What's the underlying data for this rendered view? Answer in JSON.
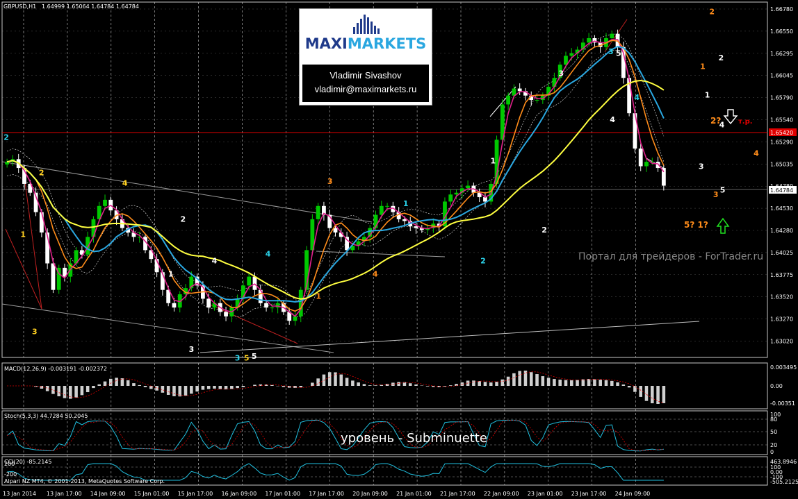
{
  "chart_header": {
    "symbol": "GBPUSD,H1",
    "ohlc": "1.64999 1.65064 1.64784 1.64784"
  },
  "logo": {
    "brand_part1": "MAXI",
    "brand_part2": "MARKETS",
    "name": "Vladimir Sivashov",
    "email": "vladimir@maximarkets.ru"
  },
  "watermark": "Портал для трейдеров - ForTrader.ru",
  "level_caption": "уровень - Subminuette",
  "copyright": "Alpari NZ MT4, © 2001-2013, MetaQuotes Software Corp.",
  "colors": {
    "background": "#000000",
    "grid": "#c8c8c8",
    "bull": "#00c800",
    "bear": "#ffffff",
    "ma_fast": "#e0208c",
    "ma_mid": "#ff8c1a",
    "ma_slow": "#2aa7e0",
    "ma_long": "#ffff40",
    "resistance_line": "#e00000"
  },
  "chart_data": [
    {
      "type": "candlestick",
      "title": "GBPUSD,H1",
      "y_ticks": [
        "1.66780",
        "1.66550",
        "1.66295",
        "1.66045",
        "1.65790",
        "1.65540",
        "1.65290",
        "1.65035",
        "1.64780",
        "1.64530",
        "1.64280",
        "1.64025",
        "1.63775",
        "1.63520",
        "1.63270",
        "1.63020"
      ],
      "ylim": [
        1.6298,
        1.6688
      ],
      "x_ticks": [
        "13 Jan 2014",
        "13 Jan 17:00",
        "14 Jan 09:00",
        "15 Jan 01:00",
        "15 Jan 17:00",
        "16 Jan 09:00",
        "17 Jan 01:00",
        "17 Jan 17:00",
        "20 Jan 09:00",
        "21 Jan 01:00",
        "21 Jan 17:00",
        "22 Jan 09:00",
        "23 Jan 01:00",
        "23 Jan 17:00",
        "24 Jan 09:00"
      ],
      "price_labels": {
        "red_line": "1.65420",
        "current": "1.64784"
      },
      "closes": [
        1.6505,
        1.6508,
        1.6498,
        1.648,
        1.647,
        1.6448,
        1.6425,
        1.639,
        1.636,
        1.6385,
        1.6375,
        1.639,
        1.6405,
        1.64,
        1.642,
        1.644,
        1.6455,
        1.6462,
        1.645,
        1.644,
        1.643,
        1.6425,
        1.642,
        1.642,
        1.6405,
        1.6395,
        1.638,
        1.636,
        1.6345,
        1.634,
        1.6355,
        1.6362,
        1.6375,
        1.6365,
        1.635,
        1.634,
        1.6345,
        1.6335,
        1.633,
        1.634,
        1.635,
        1.6365,
        1.6375,
        1.636,
        1.6345,
        1.634,
        1.634,
        1.6345,
        1.6335,
        1.6325,
        1.633,
        1.636,
        1.6405,
        1.644,
        1.6455,
        1.6445,
        1.643,
        1.6425,
        1.642,
        1.6405,
        1.641,
        1.6415,
        1.642,
        1.643,
        1.6445,
        1.6455,
        1.6455,
        1.6448,
        1.644,
        1.6438,
        1.6432,
        1.643,
        1.6428,
        1.643,
        1.6435,
        1.6432,
        1.646,
        1.6468,
        1.647,
        1.6475,
        1.6478,
        1.647,
        1.6465,
        1.646,
        1.648,
        1.653,
        1.657,
        1.658,
        1.6588,
        1.6585,
        1.658,
        1.6575,
        1.6575,
        1.658,
        1.659,
        1.66,
        1.6615,
        1.6625,
        1.6628,
        1.6632,
        1.664,
        1.6645,
        1.664,
        1.6635,
        1.6645,
        1.665,
        1.6635,
        1.66,
        1.656,
        1.652,
        1.65,
        1.6505,
        1.6505,
        1.6498,
        1.6478
      ],
      "series": [
        {
          "name": "",
          "color_key": "ma_fast"
        },
        {
          "name": "",
          "color_key": "ma_mid"
        },
        {
          "name": "",
          "color_key": "ma_slow"
        },
        {
          "name": "",
          "color_key": "ma_long"
        }
      ],
      "wave_labels": [
        {
          "text": "2",
          "color": "#2ad1e8",
          "t": 0.002,
          "p": 1.653
        },
        {
          "text": "2",
          "color": "#ffd020",
          "t": 0.048,
          "p": 1.649
        },
        {
          "text": "1",
          "color": "#ffd020",
          "t": 0.024,
          "p": 1.642
        },
        {
          "text": "3",
          "color": "#ffd020",
          "t": 0.039,
          "p": 1.631
        },
        {
          "text": "4",
          "color": "#ffd020",
          "t": 0.157,
          "p": 1.6478
        },
        {
          "text": "2",
          "color": "#ffffff",
          "t": 0.233,
          "p": 1.6437
        },
        {
          "text": "1",
          "color": "#ffffff",
          "t": 0.217,
          "p": 1.6375
        },
        {
          "text": "4",
          "color": "#ffffff",
          "t": 0.274,
          "p": 1.639
        },
        {
          "text": "3",
          "color": "#ffffff",
          "t": 0.244,
          "p": 1.629
        },
        {
          "text": "5",
          "color": "#ffffff",
          "t": 0.326,
          "p": 1.6282
        },
        {
          "text": "4",
          "color": "#2ad1e8",
          "t": 0.344,
          "p": 1.6398
        },
        {
          "text": "3",
          "color": "#2ad1e8",
          "t": 0.304,
          "p": 1.628
        },
        {
          "text": "5",
          "color": "#ffd020",
          "t": 0.316,
          "p": 1.628
        },
        {
          "text": "1",
          "color": "#ff8c1a",
          "t": 0.41,
          "p": 1.635
        },
        {
          "text": "3",
          "color": "#ff8c1a",
          "t": 0.425,
          "p": 1.648
        },
        {
          "text": "1",
          "color": "#2ad1e8",
          "t": 0.524,
          "p": 1.6455
        },
        {
          "text": "4",
          "color": "#ff8c1a",
          "t": 0.484,
          "p": 1.6375
        },
        {
          "text": "2",
          "color": "#2ad1e8",
          "t": 0.625,
          "p": 1.639
        },
        {
          "text": "1",
          "color": "#ffffff",
          "t": 0.638,
          "p": 1.6503
        },
        {
          "text": "2",
          "color": "#ffffff",
          "t": 0.705,
          "p": 1.6425
        },
        {
          "text": "3",
          "color": "#ffffff",
          "t": 0.727,
          "p": 1.6602
        },
        {
          "text": "3",
          "color": "#2ad1e8",
          "t": 0.792,
          "p": 1.6627
        },
        {
          "text": "5",
          "color": "#ffffff",
          "t": 0.802,
          "p": 1.6625
        },
        {
          "text": "4",
          "color": "#ffffff",
          "t": 0.794,
          "p": 1.655
        },
        {
          "text": "4",
          "color": "#2ad1e8",
          "t": 0.826,
          "p": 1.6575
        },
        {
          "text": "2",
          "color": "#ff8c1a",
          "t": 0.924,
          "p": 1.6672
        },
        {
          "text": "1",
          "color": "#ff8c1a",
          "t": 0.912,
          "p": 1.661
        },
        {
          "text": "2",
          "color": "#ffffff",
          "t": 0.936,
          "p": 1.662
        },
        {
          "text": "1",
          "color": "#ffffff",
          "t": 0.918,
          "p": 1.6578
        },
        {
          "text": "4",
          "color": "#ffffff",
          "t": 0.937,
          "p": 1.6544
        },
        {
          "text": "3",
          "color": "#ffffff",
          "t": 0.91,
          "p": 1.6497
        },
        {
          "text": "5",
          "color": "#ffffff",
          "t": 0.938,
          "p": 1.647
        },
        {
          "text": "3",
          "color": "#ff8c1a",
          "t": 0.929,
          "p": 1.6465
        },
        {
          "text": "4",
          "color": "#ff8c1a",
          "t": 0.982,
          "p": 1.6512
        }
      ],
      "forecast_labels": [
        {
          "text": "2?",
          "color": "#ff8c1a"
        },
        {
          "text": "т.р.",
          "color": "#e00000"
        },
        {
          "text": "5? 1?",
          "color": "#ff8c1a"
        }
      ]
    },
    {
      "type": "bar",
      "title": "MACD(12,26,9) -0.003191 -0.002372",
      "y_ticks": [
        "0.003495",
        "0.00",
        "-0.00351"
      ],
      "ylim": [
        -0.0042,
        0.0042
      ]
    },
    {
      "type": "line",
      "title": "Stoch(5,3,3) 44.7284 50.2045",
      "y_ticks": [
        "100",
        "80",
        "50",
        "20",
        "0"
      ],
      "ylim": [
        0,
        100
      ]
    },
    {
      "type": "line",
      "title": "CCI(20) -85.2145",
      "y_ticks": [
        "463.8946",
        "100",
        "0.00",
        "-100",
        "-505.2125"
      ],
      "left_ticks": [
        "200",
        "-200"
      ],
      "ylim": [
        -505.2125,
        463.8946
      ]
    }
  ]
}
